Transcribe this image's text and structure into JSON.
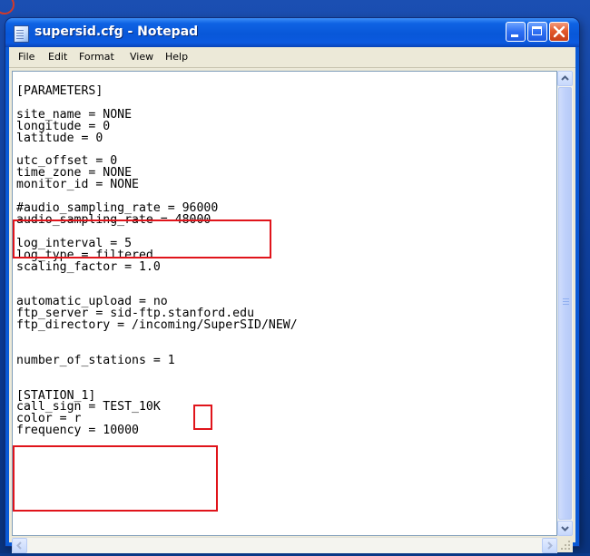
{
  "window": {
    "title": "supersid.cfg - Notepad",
    "icon": "notepad-icon",
    "controls": [
      "minimize-icon",
      "maximize-icon",
      "close-icon"
    ]
  },
  "menu": [
    "File",
    "Edit",
    "Format",
    "View",
    "Help"
  ],
  "editor": {
    "content": "[PARAMETERS]\n\nsite_name = NONE\nlongitude = 0\nlatitude = 0\n\nutc_offset = 0\ntime_zone = NONE\nmonitor_id = NONE\n\n#audio_sampling_rate = 96000\naudio_sampling_rate = 48000\n\nlog_interval = 5\nlog_type = filtered\nscaling_factor = 1.0\n\n\nautomatic_upload = no\nftp_server = sid-ftp.stanford.edu\nftp_directory = /incoming/SuperSID/NEW/\n\n\nnumber_of_stations = 1\n\n\n[STATION_1]\ncall_sign = TEST_10K\ncolor = r\nfrequency = 10000"
  },
  "colors": {
    "highlight_box": "#e0141b",
    "titlebar": "#0857d8",
    "desktop": "#0b3b98"
  }
}
